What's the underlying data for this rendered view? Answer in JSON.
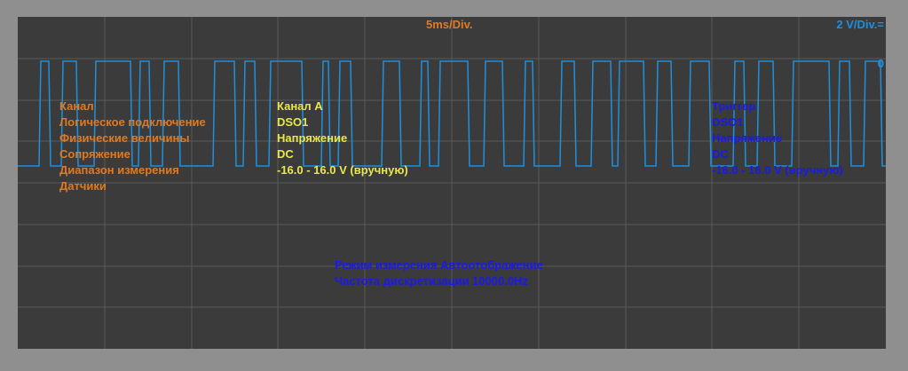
{
  "scope": {
    "time_div": "5ms/Div.",
    "volt_div": "2 V/Div.=",
    "zero_marker": "0",
    "grid": {
      "cols": 10,
      "rows": 8
    },
    "colors": {
      "background": "#3b3b3b",
      "grid": "#5a5a5a",
      "trace": "#1e90e0",
      "labels": "#e07a22",
      "channel_values": "#e8e84a",
      "trigger_values": "#1a1ae8"
    }
  },
  "labels": {
    "channel": "Канал",
    "logical": "Логическое подключение",
    "physical": "Физические величины",
    "coupling": "Сопряжение",
    "range": "Диапазон измерения",
    "sensors": "Датчики"
  },
  "channel_a": {
    "name": "Канал A",
    "logical": "DSO1",
    "physical": "Напряжение",
    "coupling": "DC",
    "range": "-16.0 - 16.0 V (вручную)"
  },
  "trigger": {
    "name": "Триггер",
    "logical": "DSO1",
    "physical": "Напряжение",
    "coupling": "DC",
    "range": "-16.0 - 16.0 V (вручную)"
  },
  "footer": {
    "mode": "Режим измерения  Автоотображение",
    "sample_rate": "Частота дискретизации  10000.0Hz"
  }
}
